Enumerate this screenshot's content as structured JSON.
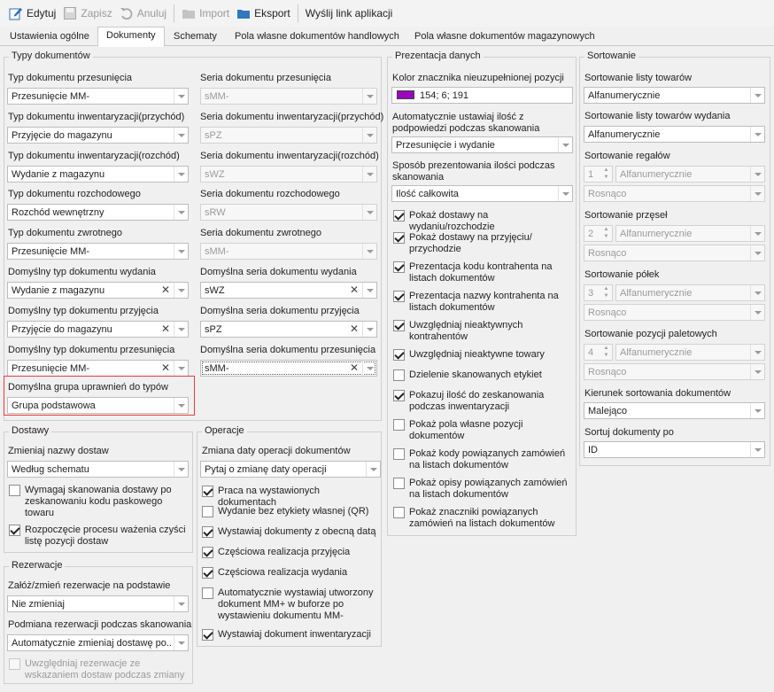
{
  "toolbar": {
    "edit": "Edytuj",
    "save": "Zapisz",
    "cancel": "Anuluj",
    "import": "Import",
    "export": "Eksport",
    "send_link": "Wyślij link aplikacji"
  },
  "tabs": [
    "Ustawienia ogólne",
    "Dokumenty",
    "Schematy",
    "Pola własne dokumentów handlowych",
    "Pola własne dokumentów magazynowych"
  ],
  "doc_types": {
    "title": "Typy dokumentów",
    "rows": [
      {
        "type_label": "Typ dokumentu przesunięcia",
        "type_value": "Przesunięcie MM-",
        "series_label": "Seria dokumentu przesunięcia",
        "series_value": "sMM-"
      },
      {
        "type_label": "Typ dokumentu inwentaryzacji(przychód)",
        "type_value": "Przyjęcie do magazynu",
        "series_label": "Seria dokumentu inwentaryzacji(przychód)",
        "series_value": "sPZ"
      },
      {
        "type_label": "Typ dokumentu inwentaryzacji(rozchód)",
        "type_value": "Wydanie z magazynu",
        "series_label": "Seria dokumentu inwentaryzacji(rozchód)",
        "series_value": "sWZ"
      },
      {
        "type_label": "Typ dokumentu rozchodowego",
        "type_value": "Rozchód wewnętrzny",
        "series_label": "Seria dokumentu rozchodowego",
        "series_value": "sRW"
      },
      {
        "type_label": "Typ dokumentu zwrotnego",
        "type_value": "Przesunięcie MM-",
        "series_label": "Seria dokumentu zwrotnego",
        "series_value": "sMM-"
      },
      {
        "type_label": "Domyślny typ dokumentu wydania",
        "type_value": "Wydanie z magazynu",
        "series_label": "Domyślna seria dokumentu wydania",
        "series_value": "sWZ"
      },
      {
        "type_label": "Domyślny typ dokumentu przyjęcia",
        "type_value": "Przyjęcie do magazynu",
        "series_label": "Domyślna seria dokumentu przyjęcia",
        "series_value": "sPZ"
      },
      {
        "type_label": "Domyślny typ dokumentu przesunięcia",
        "type_value": "Przesunięcie MM-",
        "series_label": "Domyślna seria dokumentu przesunięcia",
        "series_value": "sMM-"
      }
    ],
    "group_label": "Domyślna grupa uprawnień do typów",
    "group_value": "Grupa podstawowa"
  },
  "deliveries": {
    "title": "Dostawy",
    "name_label": "Zmieniaj nazwy dostaw",
    "name_value": "Według schematu",
    "require_scan": "Wymagaj skanowania dostawy po zeskanowaniu kodu paskowego towaru",
    "weigh_clear": "Rozpoczęcie procesu ważenia czyści listę pozycji dostaw"
  },
  "reservations": {
    "title": "Rezerwacje",
    "create_label": "Załóż/zmień rezerwacje na podstawie",
    "create_value": "Nie zmieniaj",
    "replace_label": "Podmiana rezerwacji podczas skanowania",
    "replace_value": "Automatycznie zmieniaj dostawę po...",
    "include_label": "Uwzględniaj rezerwacje ze wskazaniem dostaw podczas zmiany"
  },
  "operations": {
    "title": "Operacje",
    "date_label": "Zmiana daty operacji dokumentów",
    "date_value": "Pytaj o zmianę daty operacji",
    "checks": [
      {
        "label": "Praca na wystawionych dokumentach",
        "checked": true
      },
      {
        "label": "Wydanie bez etykiety własnej (QR)",
        "checked": false
      },
      {
        "label": "Wystawiaj dokumenty z obecną datą",
        "checked": true
      },
      {
        "label": "Częściowa realizacja przyjęcia",
        "checked": true
      },
      {
        "label": "Częściowa realizacja wydania",
        "checked": true
      },
      {
        "label": "Automatycznie wystawiaj utworzony dokument MM+ w buforze po wystawieniu dokumentu MM-",
        "checked": false
      },
      {
        "label": "Wystawiaj dokument inwentaryzacji",
        "checked": true
      }
    ]
  },
  "presentation": {
    "title": "Prezentacja danych",
    "color_label": "Kolor znacznika nieuzupełnionej pozycji",
    "color_value": "154; 6; 191",
    "color_hex": "#9a06bf",
    "auto_qty_label": "Automatycznie ustawiaj ilość z podpowiedzi podczas skanowania",
    "auto_qty_value": "Przesunięcie i wydanie",
    "qty_mode_label": "Sposób prezentowania ilości podczas skanowania",
    "qty_mode_value": "Ilość całkowita",
    "checks": [
      {
        "label": "Pokaż dostawy na wydaniu/rozchodzie",
        "checked": true
      },
      {
        "label": "Pokaż dostawy na przyjęciu/ przychodzie",
        "checked": true
      },
      {
        "label": "Prezentacja kodu kontrahenta na listach dokumentów",
        "checked": true
      },
      {
        "label": "Prezentacja nazwy kontrahenta na listach dokumentów",
        "checked": true
      },
      {
        "label": "Uwzględniaj nieaktywnych kontrahentów",
        "checked": true
      },
      {
        "label": "Uwzględniaj nieaktywne towary",
        "checked": true
      },
      {
        "label": "Dzielenie skanowanych etykiet",
        "checked": false
      },
      {
        "label": "Pokazuj ilość do zeskanowania podczas inwentaryzacji",
        "checked": true
      },
      {
        "label": "Pokaż pola własne pozycji dokumentów",
        "checked": false
      },
      {
        "label": "Pokaż kody powiązanych zamówień na listach dokumentów",
        "checked": false
      },
      {
        "label": "Pokaż opisy powiązanych zamówień na listach dokumentów",
        "checked": false
      },
      {
        "label": "Pokaż znaczniki powiązanych zamówień na listach dokumentów",
        "checked": false
      }
    ]
  },
  "sorting": {
    "title": "Sortowanie",
    "items_label": "Sortowanie listy towarów",
    "items_value": "Alfanumerycznie",
    "issue_label": "Sortowanie listy towarów wydania",
    "issue_value": "Alfanumerycznie",
    "multi": [
      {
        "label": "Sortowanie regałów",
        "num": "1",
        "mode": "Alfanumerycznie",
        "dir": "Rosnąco"
      },
      {
        "label": "Sortowanie przęseł",
        "num": "2",
        "mode": "Alfanumerycznie",
        "dir": "Rosnąco"
      },
      {
        "label": "Sortowanie półek",
        "num": "3",
        "mode": "Alfanumerycznie",
        "dir": "Rosnąco"
      },
      {
        "label": "Sortowanie pozycji paletowych",
        "num": "4",
        "mode": "Alfanumerycznie",
        "dir": "Rosnąco"
      }
    ],
    "direction_label": "Kierunek sortowania dokumentów",
    "direction_value": "Malejąco",
    "sort_by_label": "Sortuj dokumenty po",
    "sort_by_value": "ID"
  }
}
